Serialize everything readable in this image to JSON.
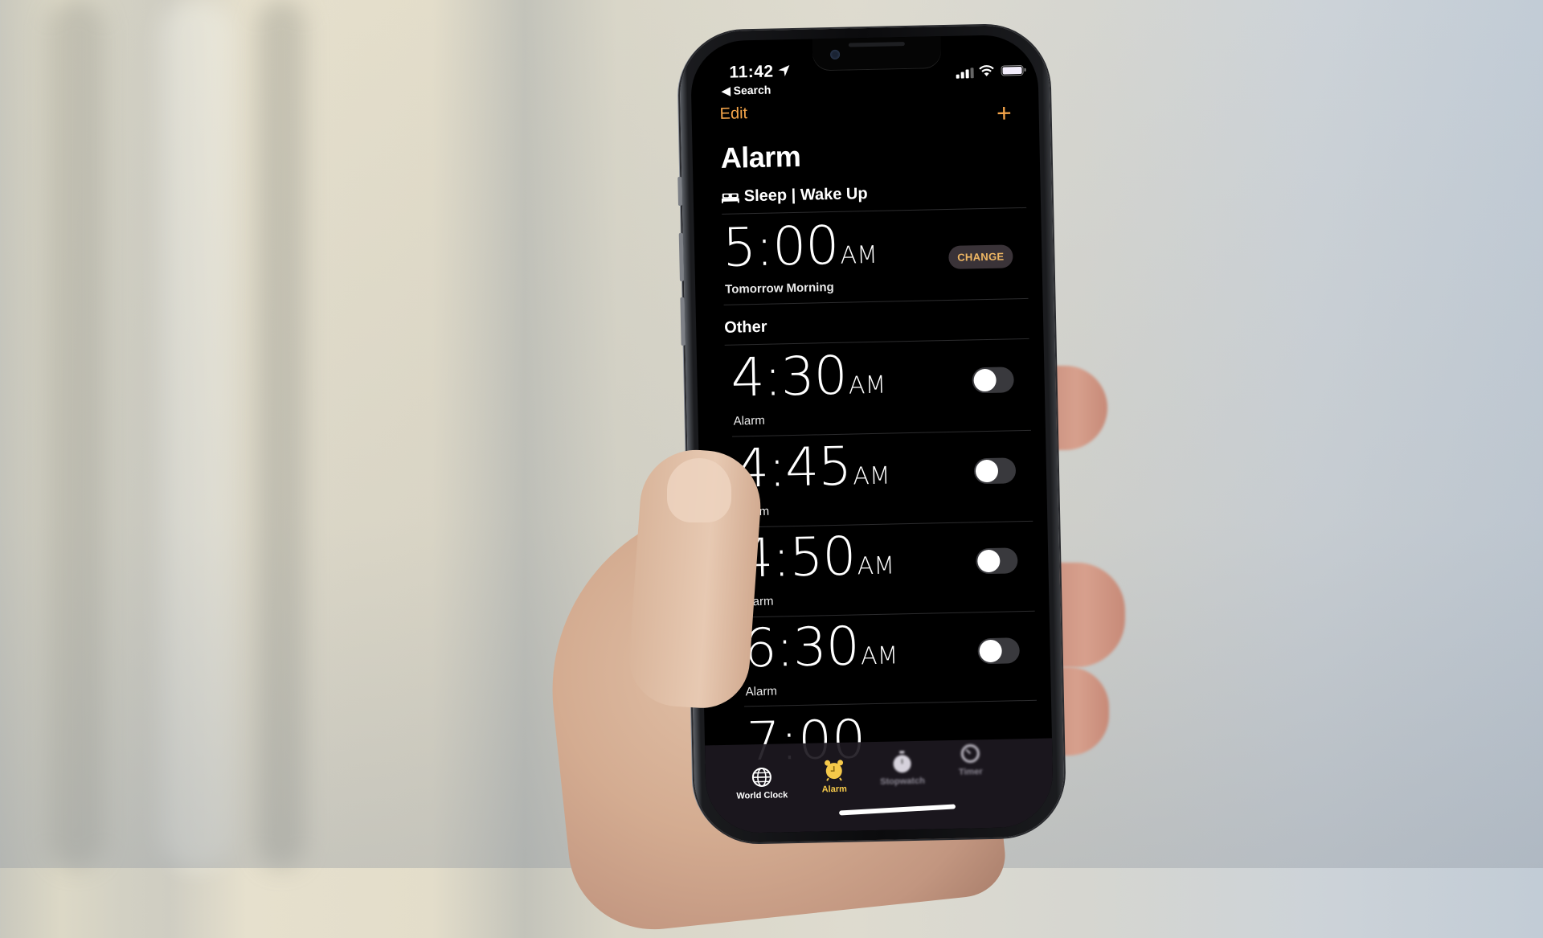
{
  "status_bar": {
    "time": "11:42",
    "back_label": "Search",
    "location_icon": "location-arrow-icon",
    "signal_icon": "cellular-signal-icon",
    "wifi_icon": "wifi-icon",
    "battery_icon": "battery-icon"
  },
  "nav": {
    "edit_label": "Edit",
    "add_label": "+",
    "title": "Alarm"
  },
  "sleep_section": {
    "header": "Sleep | Wake Up",
    "icon": "bed-icon",
    "alarm": {
      "time": "5:00",
      "period": "AM",
      "label": "Tomorrow Morning",
      "button_label": "CHANGE"
    }
  },
  "other_section": {
    "header": "Other",
    "alarms": [
      {
        "time": "4:30",
        "period": "AM",
        "label": "Alarm",
        "enabled": false
      },
      {
        "time": "4:45",
        "period": "AM",
        "label": "Alarm",
        "enabled": false
      },
      {
        "time": "4:50",
        "period": "AM",
        "label": "Alarm",
        "enabled": false
      },
      {
        "time": "6:30",
        "period": "AM",
        "label": "Alarm",
        "enabled": false
      }
    ],
    "partial_next": "7:00"
  },
  "tab_bar": {
    "tabs": [
      {
        "label": "World Clock",
        "icon": "globe-icon",
        "active": false
      },
      {
        "label": "Alarm",
        "icon": "alarm-clock-icon",
        "active": true
      },
      {
        "label": "Stopwatch",
        "icon": "stopwatch-icon",
        "active": false
      },
      {
        "label": "Timer",
        "icon": "timer-icon",
        "active": false
      }
    ]
  },
  "colors": {
    "accent": "#f5a54a",
    "active_tab": "#f5c94a",
    "toggle_off": "#39393d",
    "change_button_bg": "#3a3338",
    "change_button_text": "#f0b864"
  }
}
